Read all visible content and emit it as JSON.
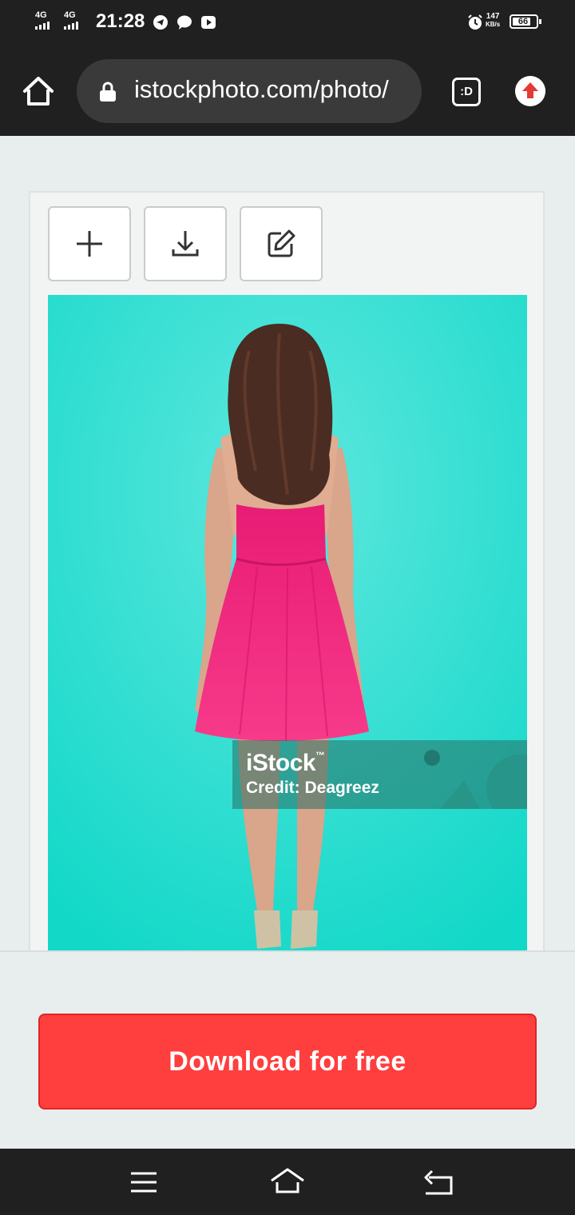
{
  "status_bar": {
    "network_1": "4G",
    "network_2": "4G",
    "time": "21:28",
    "icons": [
      "telegram-icon",
      "message-bubble-icon",
      "youtube-icon",
      "alarm-icon"
    ],
    "speed_value": "147",
    "speed_unit": "KB/s",
    "battery": "66"
  },
  "browser": {
    "url": "istockphoto.com/photo/",
    "tab_indicator": ":D",
    "icons": {
      "home": "home-icon",
      "lock": "lock-icon",
      "update": "arrow-up-icon"
    }
  },
  "toolbar": {
    "buttons": [
      {
        "name": "add-button",
        "icon": "plus-icon"
      },
      {
        "name": "download-button",
        "icon": "download-icon"
      },
      {
        "name": "edit-button",
        "icon": "edit-icon"
      }
    ]
  },
  "image": {
    "watermark_brand": "iStock",
    "watermark_tm": "™",
    "credit": "Credit: Deagreez",
    "background_color": "#2ee0d0",
    "dress_color": "#f0257a"
  },
  "cta": {
    "label": "Download for free",
    "color": "#ff3e3e"
  },
  "nav_bar": {
    "icons": [
      "menu-icon",
      "home-outline-icon",
      "back-icon"
    ]
  }
}
